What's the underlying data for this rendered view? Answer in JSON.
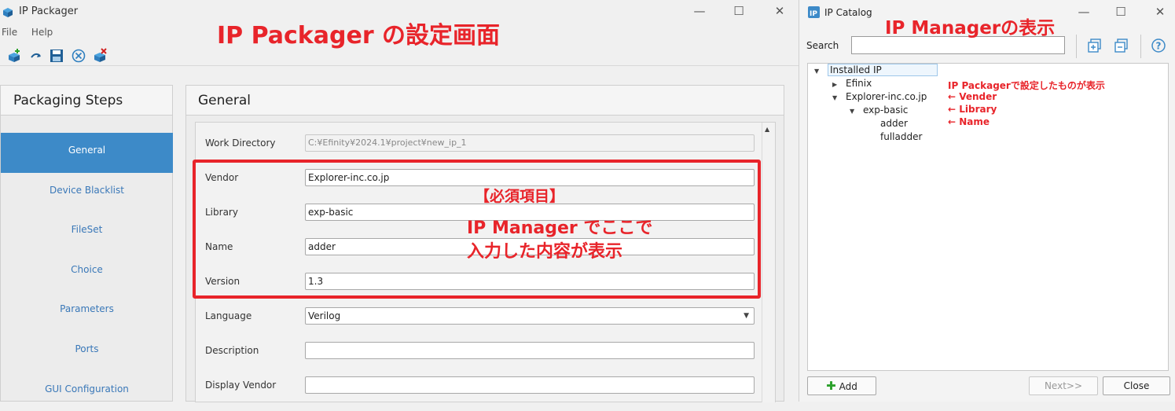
{
  "packager": {
    "title": "IP Packager",
    "menu": [
      "File",
      "Help"
    ],
    "steps_header": "Packaging Steps",
    "steps": [
      "General",
      "Device Blacklist",
      "FileSet",
      "Choice",
      "Parameters",
      "Ports",
      "GUI Configuration"
    ],
    "active_step": "General",
    "main_header": "General",
    "fields": {
      "work_directory": {
        "label": "Work Directory",
        "value": "C:¥Efinity¥2024.1¥project¥new_ip_1"
      },
      "vendor": {
        "label": "Vendor",
        "value": "Explorer-inc.co.jp"
      },
      "library": {
        "label": "Library",
        "value": "exp-basic"
      },
      "name": {
        "label": "Name",
        "value": "adder"
      },
      "version": {
        "label": "Version",
        "value": "1.3"
      },
      "language": {
        "label": "Language",
        "value": "Verilog"
      },
      "description": {
        "label": "Description",
        "value": ""
      },
      "display_vendor": {
        "label": "Display Vendor",
        "value": ""
      }
    }
  },
  "catalog": {
    "title": "IP Catalog",
    "search_label": "Search",
    "search_value": "",
    "tree": {
      "root": "Installed IP",
      "efinix": "Efinix",
      "vendor": "Explorer-inc.co.jp",
      "library": "exp-basic",
      "items": [
        "adder",
        "fulladder"
      ]
    },
    "buttons": {
      "add": "Add",
      "next": "Next>>",
      "close": "Close"
    }
  },
  "annotations": {
    "packager_heading": "IP Packager の設定画面",
    "catalog_heading": "IP Managerの表示",
    "required_title": "【必須項目】",
    "required_line1": "IP Manager でここで",
    "required_line2": "入力した内容が表示",
    "tree_note": "IP Packagerで設定したものが表示",
    "arrow_vendor": "← Vender",
    "arrow_library": "← Library",
    "arrow_name": "← Name"
  },
  "colors": {
    "accent": "#3d8ac8",
    "annotation": "#e8242a"
  }
}
